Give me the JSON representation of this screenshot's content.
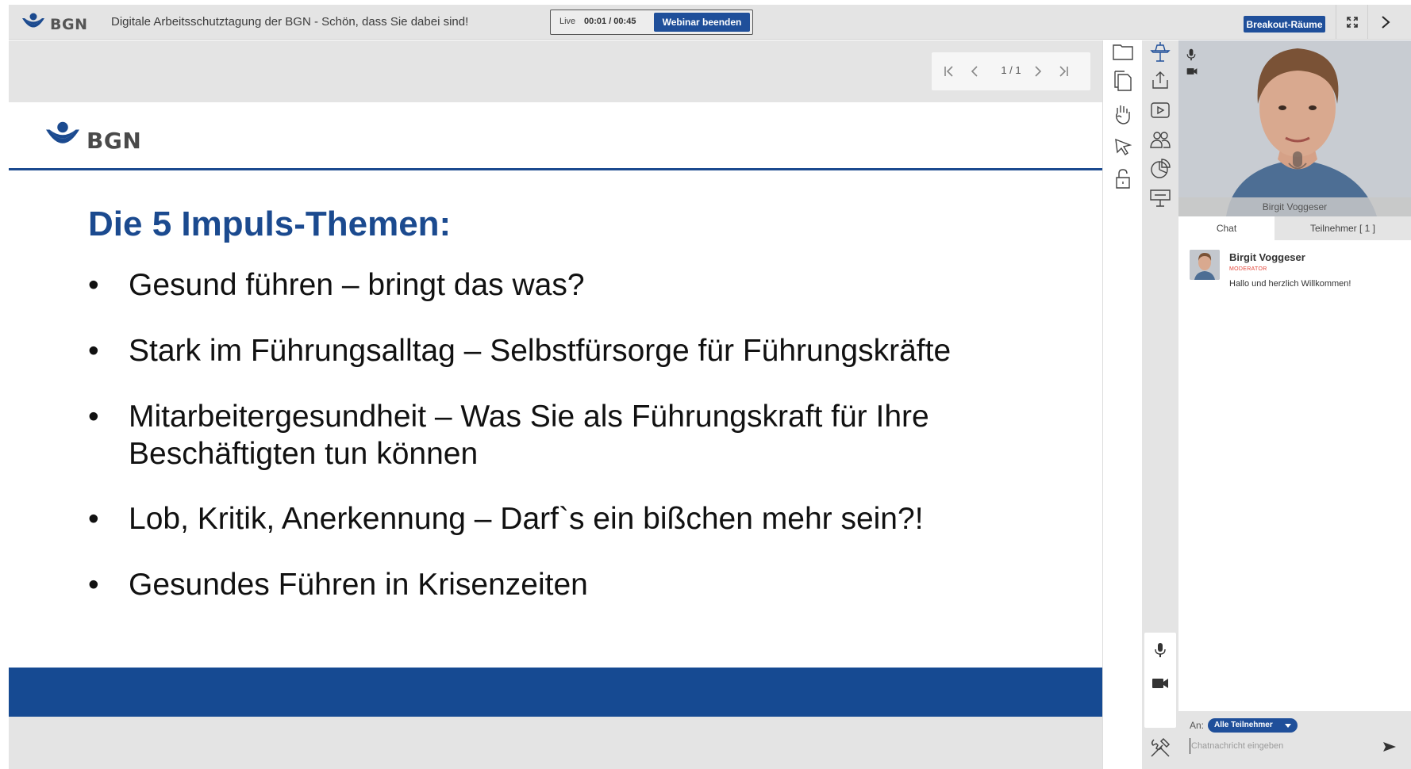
{
  "app": {
    "brand": "BGN",
    "title": "Digitale Arbeitsschutztagung der BGN - Schön, dass Sie dabei sind!",
    "live_label": "Live",
    "live_time": "00:01 / 00:45",
    "end_webinar_label": "Webinar beenden",
    "breakout_label": "Breakout-Räume",
    "accent_color": "#1f4f9a"
  },
  "pager": {
    "count": "1 / 1"
  },
  "slide": {
    "brand": "BGN",
    "heading": "Die 5 Impuls-Themen:",
    "bullet_glyph": "•",
    "bullets": [
      "Gesund führen – bringt das was?",
      "Stark im Führungsalltag – Selbstfürsorge für Führungskräfte",
      "Mitarbeitergesundheit – Was Sie als Führungskraft für Ihre",
      "Beschäftigten tun können",
      "Lob, Kritik, Anerkennung – Darf`s ein bißchen mehr sein?!",
      "Gesundes Führen in Krisenzeiten"
    ],
    "heading_color": "#1b4a8f",
    "footer_color": "#164a92"
  },
  "tools": {
    "left": [
      "folder-icon",
      "copy-icon",
      "hand-icon",
      "pointer-icon",
      "lock-icon"
    ],
    "right": [
      "presenter-icon",
      "share-upload-icon",
      "play-video-icon",
      "participants-icon",
      "pie-chart-icon",
      "whiteboard-icon",
      "mic-icon",
      "camera-icon",
      "settings-tools-icon"
    ]
  },
  "video": {
    "name": "Birgit Voggeser"
  },
  "tabs": {
    "chat": "Chat",
    "participants": "Teilnehmer [ 1 ]"
  },
  "chat": {
    "messages": [
      {
        "author": "Birgit Voggeser",
        "role": "MODERATOR",
        "text": "Hallo und herzlich Willkommen!"
      }
    ],
    "to_label": "An:",
    "recipient": "Alle Teilnehmer",
    "input_placeholder": "Chatnachricht eingeben"
  }
}
